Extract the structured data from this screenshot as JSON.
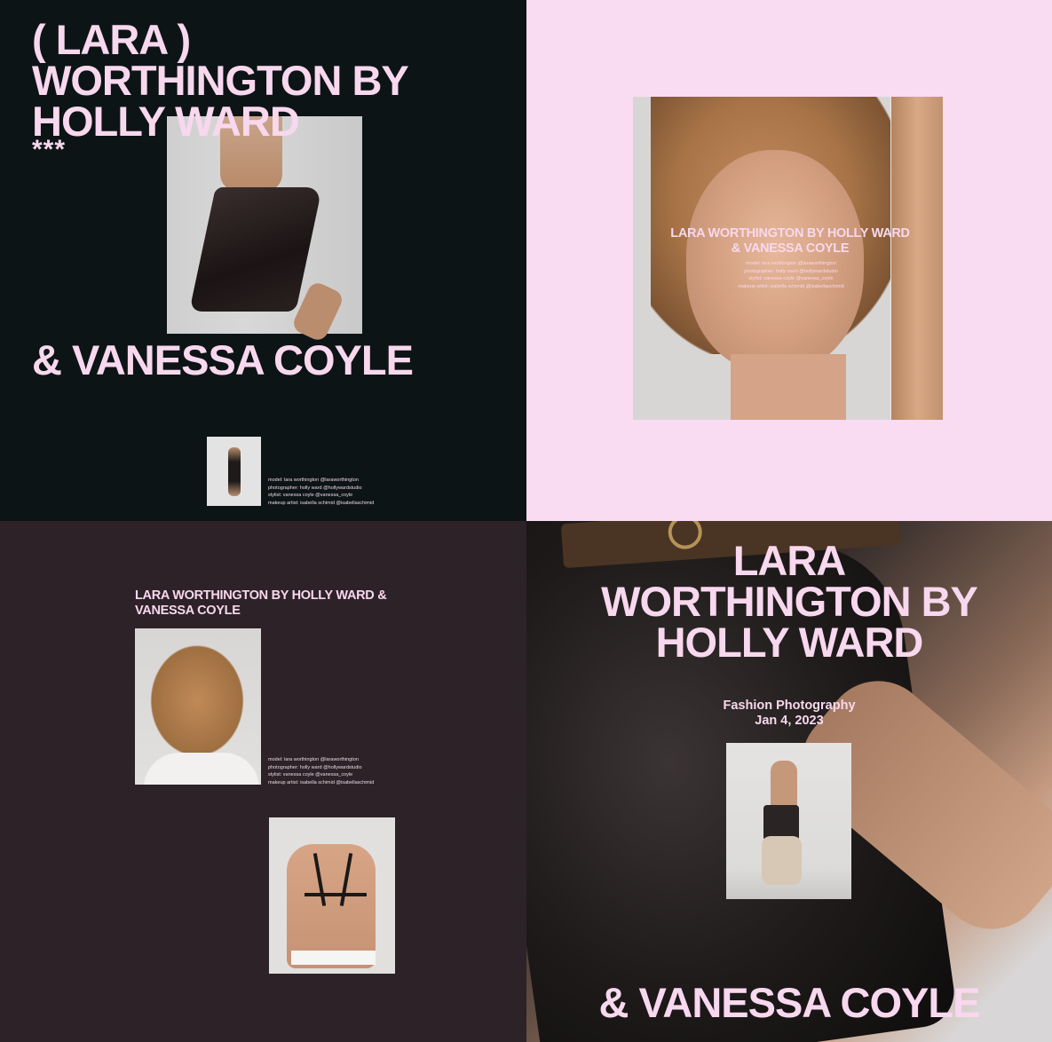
{
  "panel1": {
    "title": "( LARA )\nWORTHINGTON BY\nHOLLY WARD",
    "stars": "***",
    "bottom_title": "& VANESSA COYLE",
    "credits": [
      "model: lara worthington @laraworthington",
      "photographer: holly ward @hollywardstudio",
      "stylist: vanessa coyle @vanessa_coyle",
      "makeup artist: isabella schimid @isabellaschimid"
    ]
  },
  "panel2": {
    "overlay_title": "LARA WORTHINGTON BY HOLLY WARD & VANESSA COYLE",
    "overlay_credits": [
      "model: lara worthington @laraworthington",
      "photographer: holly ward @hollywardstudio",
      "stylist: vanessa coyle @vanessa_coyle",
      "makeup artist: isabella schimid @isabellaschimid"
    ]
  },
  "panel3": {
    "heading": "LARA WORTHINGTON BY HOLLY WARD & VANESSA COYLE",
    "credits": [
      "model: lara worthington @laraworthington",
      "photographer: holly ward @hollywardstudio",
      "stylist: vanessa coyle @vanessa_coyle",
      "makeup artist: isabella schimid @isabellaschimid"
    ]
  },
  "panel4": {
    "title": "LARA\nWORTHINGTON BY\nHOLLY WARD",
    "category": "Fashion Photography",
    "date": "Jan 4, 2023",
    "bottom_title": "& VANESSA COYLE"
  },
  "colors": {
    "accent_pink": "#f8d8ee",
    "panel1_bg": "#0d1416",
    "panel2_bg": "#f9dbf2",
    "panel3_bg": "#2d2228"
  }
}
